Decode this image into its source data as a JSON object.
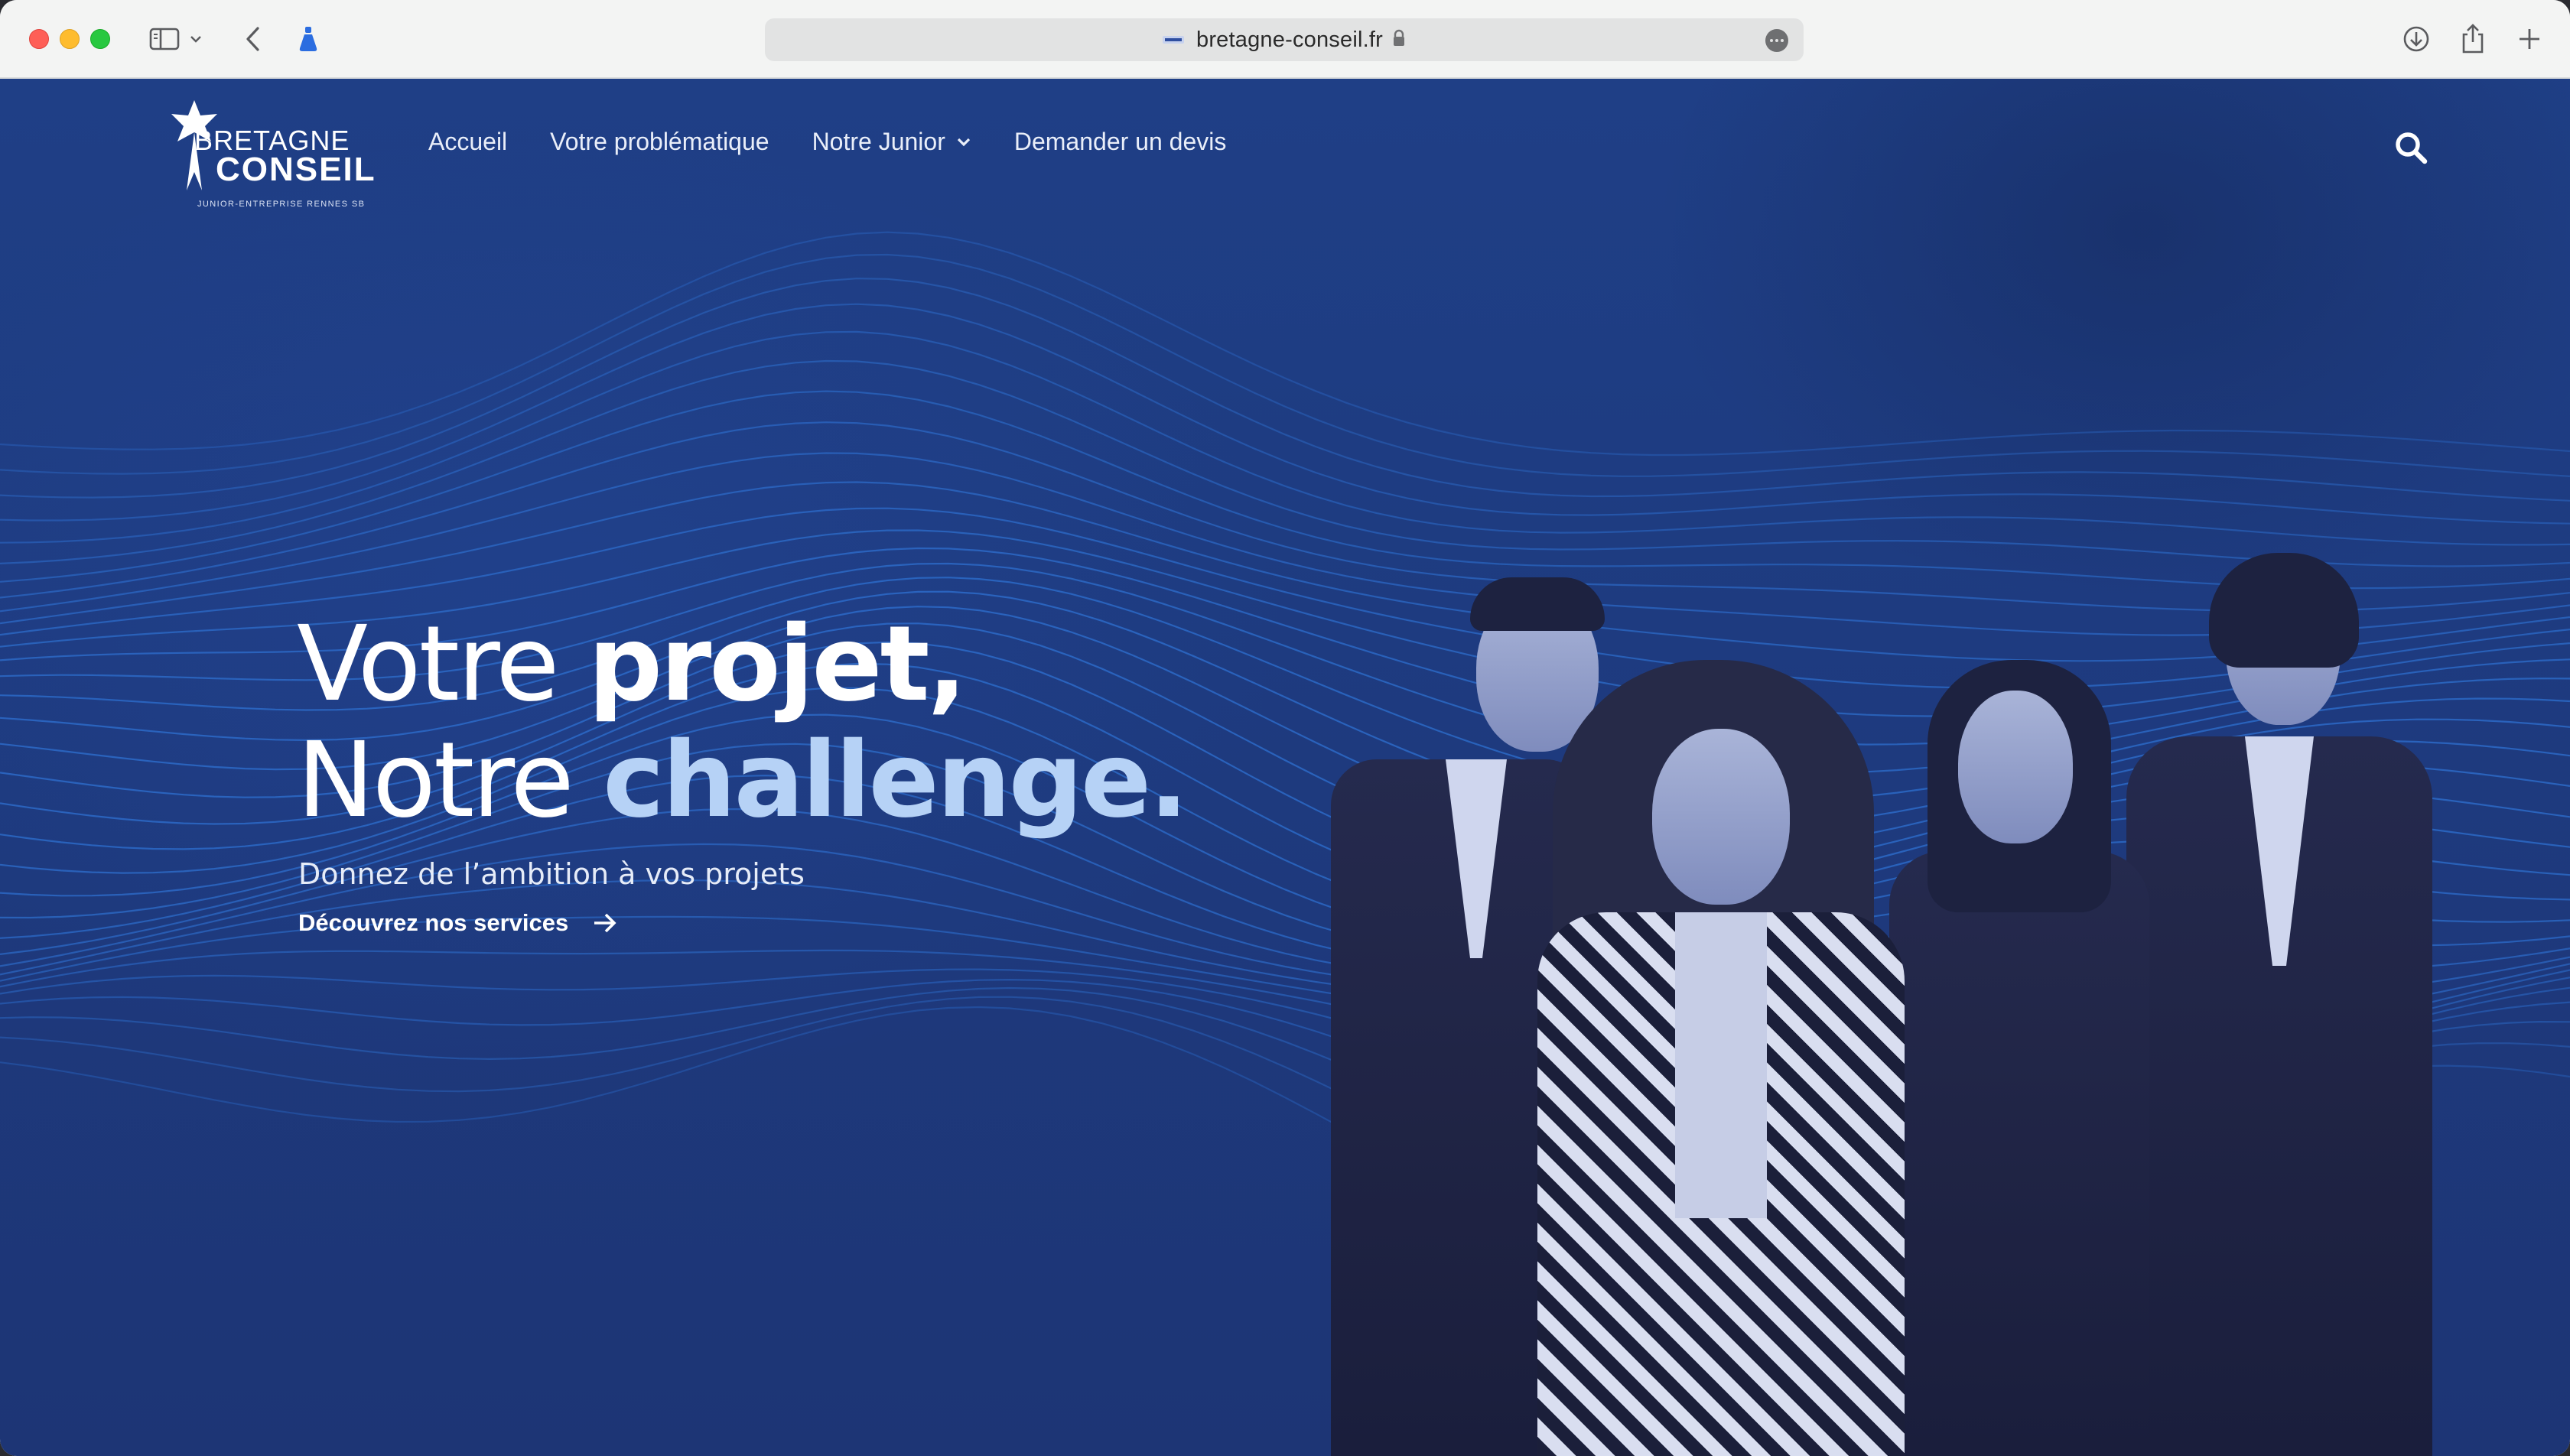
{
  "browser": {
    "url": "bretagne-conseil.fr",
    "toolbar_icons": [
      "sidebar-icon",
      "chevron-down-icon",
      "back-arrow-icon",
      "extension-icon",
      "lock-icon",
      "more-icon",
      "download-icon",
      "share-icon",
      "new-tab-plus-icon"
    ]
  },
  "site": {
    "logo": {
      "line1": "BRETAGNE",
      "line2": "CONSEIL",
      "tagline": "JUNIOR-ENTREPRISE RENNES SB"
    },
    "nav": [
      {
        "label": "Accueil"
      },
      {
        "label": "Votre problématique"
      },
      {
        "label": "Notre Junior",
        "has_dropdown": true
      },
      {
        "label": "Demander un devis"
      }
    ],
    "hero": {
      "title_line1_light": "Votre ",
      "title_line1_bold": "projet,",
      "title_line2_light": "Notre ",
      "title_line2_accent": "challenge.",
      "subtitle": "Donnez de l’ambition à vos projets",
      "cta": "Découvrez nos services"
    },
    "colors": {
      "background": "#1f3f86",
      "accent_text": "#b6d2f6",
      "wave_lines": "#2f74d6"
    }
  }
}
